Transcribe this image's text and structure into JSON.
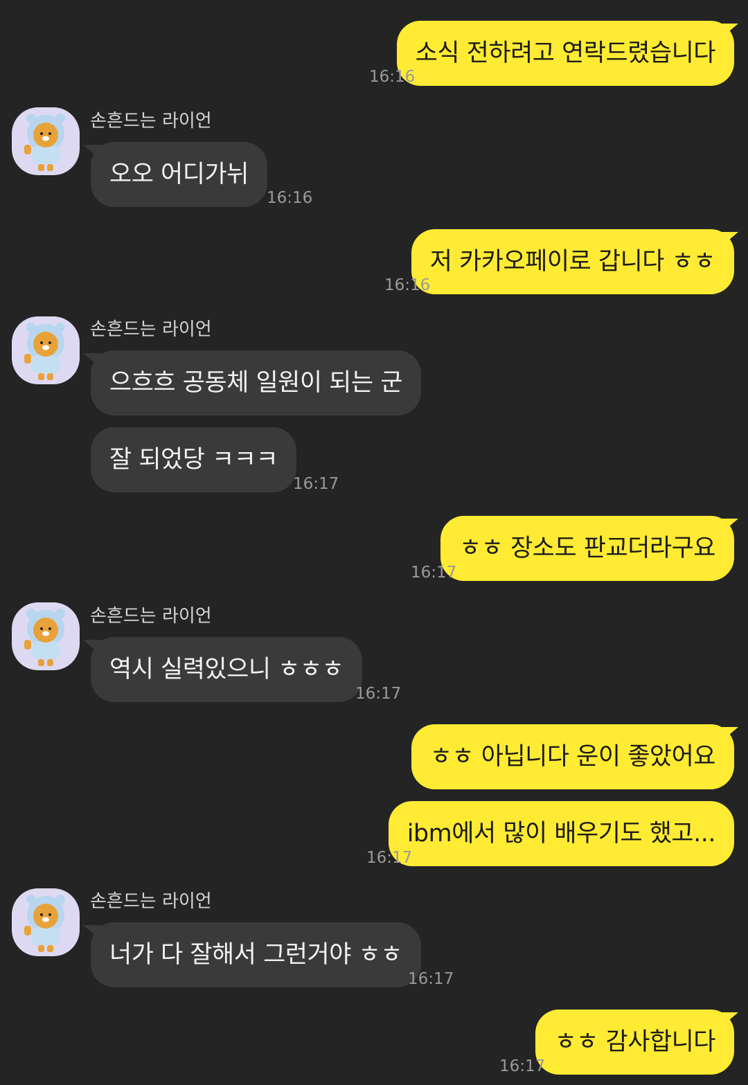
{
  "conversation": {
    "friend_name": "손흔드는 라이언",
    "messages": [
      {
        "sender": "me",
        "text": "소식 전하려고 연락드렸습니다",
        "time": "16:16"
      },
      {
        "sender": "friend",
        "text": "오오 어디가뉘",
        "time": "16:16"
      },
      {
        "sender": "me",
        "text": "저 카카오페이로 갑니다 ㅎㅎ",
        "time": "16:16"
      },
      {
        "sender": "friend",
        "text": "으흐흐 공동체 일원이 되는 군",
        "time": ""
      },
      {
        "sender": "friend",
        "text": "잘 되었당 ㅋㅋㅋ",
        "time": "16:17"
      },
      {
        "sender": "me",
        "text": "ㅎㅎ 장소도 판교더라구요",
        "time": "16:17"
      },
      {
        "sender": "friend",
        "text": "역시 실력있으니 ㅎㅎㅎ",
        "time": "16:17"
      },
      {
        "sender": "me",
        "text": "ㅎㅎ 아닙니다 운이 좋았어요",
        "time": ""
      },
      {
        "sender": "me",
        "text": "ibm에서 많이 배우기도 했고...",
        "time": "16:17"
      },
      {
        "sender": "friend",
        "text": "너가 다 잘해서 그런거야 ㅎㅎ",
        "time": "16:17"
      },
      {
        "sender": "me",
        "text": "ㅎㅎ 감사합니다",
        "time": "16:17"
      }
    ]
  },
  "theme": {
    "background": "#242424",
    "my_bubble": "#ffeb33",
    "friend_bubble": "#3a3a3a",
    "avatar_background": "#ded9f2",
    "timestamp": "#9a9a9a"
  },
  "icons": {
    "avatar": "ryan-avatar-icon"
  }
}
